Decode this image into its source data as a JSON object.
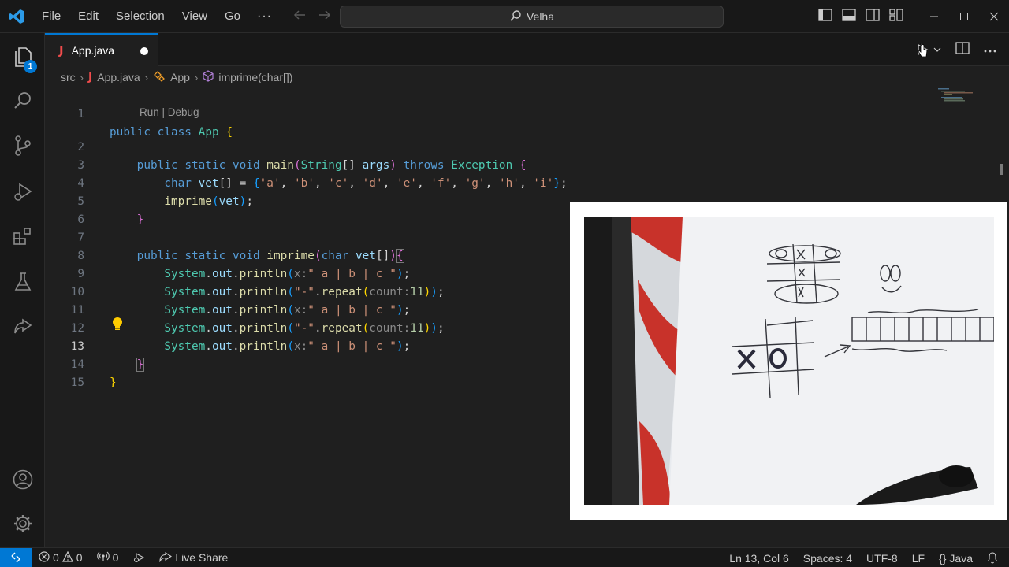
{
  "menu": [
    "File",
    "Edit",
    "Selection",
    "View",
    "Go"
  ],
  "menu_more": "···",
  "search": {
    "label": "Velha"
  },
  "activity": {
    "explorer_badge": "1"
  },
  "tab": {
    "icon_letter": "J",
    "label": "App.java"
  },
  "breadcrumb": {
    "folder": "src",
    "file": "App.java",
    "class": "App",
    "method": "imprime(char[])"
  },
  "codelens": "Run | Debug",
  "line_numbers": [
    "1",
    "2",
    "3",
    "4",
    "5",
    "6",
    "7",
    "8",
    "9",
    "10",
    "11",
    "12",
    "13",
    "14",
    "15"
  ],
  "code": {
    "l1": [
      "public",
      "class",
      "App"
    ],
    "l2": [
      "public",
      "static",
      "void",
      "main",
      "String",
      "args",
      "throws",
      "Exception"
    ],
    "l3": [
      "char",
      "vet",
      "'a'",
      "'b'",
      "'c'",
      "'d'",
      "'e'",
      "'f'",
      "'g'",
      "'h'",
      "'i'"
    ],
    "l4": [
      "imprime",
      "vet"
    ],
    "l7": [
      "public",
      "static",
      "void",
      "imprime",
      "char",
      "vet"
    ],
    "println_hint": "x:",
    "count_hint": "count:",
    "row_string": "\" a | b | c \"",
    "dash_string": "\"-\"",
    "repeat_count": "11",
    "system": "System",
    "out": "out",
    "println": "println",
    "repeat": "repeat"
  },
  "status": {
    "errors": "0",
    "warnings": "0",
    "ports": "0",
    "live_share": "Live Share",
    "position": "Ln 13, Col 6",
    "spaces": "Spaces: 4",
    "encoding": "UTF-8",
    "eol": "LF",
    "language": "Java",
    "language_icon": "{}"
  },
  "colors": {
    "accent": "#0078d4",
    "background": "#1f1f1f",
    "chrome": "#181818"
  }
}
